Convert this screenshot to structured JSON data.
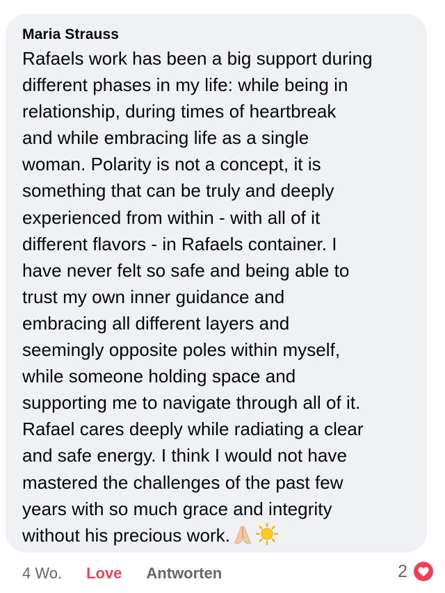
{
  "comment": {
    "author": "Maria Strauss",
    "text": "Rafaels work has been a big support during\ndifferent phases in my life: while being in\nrelationship, during times of heartbreak\nand while embracing life as a single\nwoman. Polarity is not a concept, it is\nsomething that can be truly and deeply\nexperienced from within - with all of it\ndifferent flavors -  in Rafaels container. I\nhave never felt so safe and being able to\ntrust my own inner guidance and\nembracing all different layers and\nseemingly opposite poles within myself,\nwhile someone holding space and\nsupporting me to navigate through all of it.\nRafael cares deeply while radiating a clear\nand safe energy. I think I would not have\nmastered the challenges of the past few\nyears with so much grace and integrity\nwithout his precious work.",
    "emojis": [
      "praying-hands-icon",
      "sun-icon"
    ]
  },
  "actions": {
    "timestamp": "4 Wo.",
    "love_label": "Love",
    "reply_label": "Antworten"
  },
  "reactions": {
    "count": "2",
    "icon": "heart-reaction-icon",
    "color": "#f33e58"
  },
  "colors": {
    "bubble": "#f0f1f5",
    "text": "#050505",
    "secondary": "#65676b",
    "love": "#e8475a"
  }
}
